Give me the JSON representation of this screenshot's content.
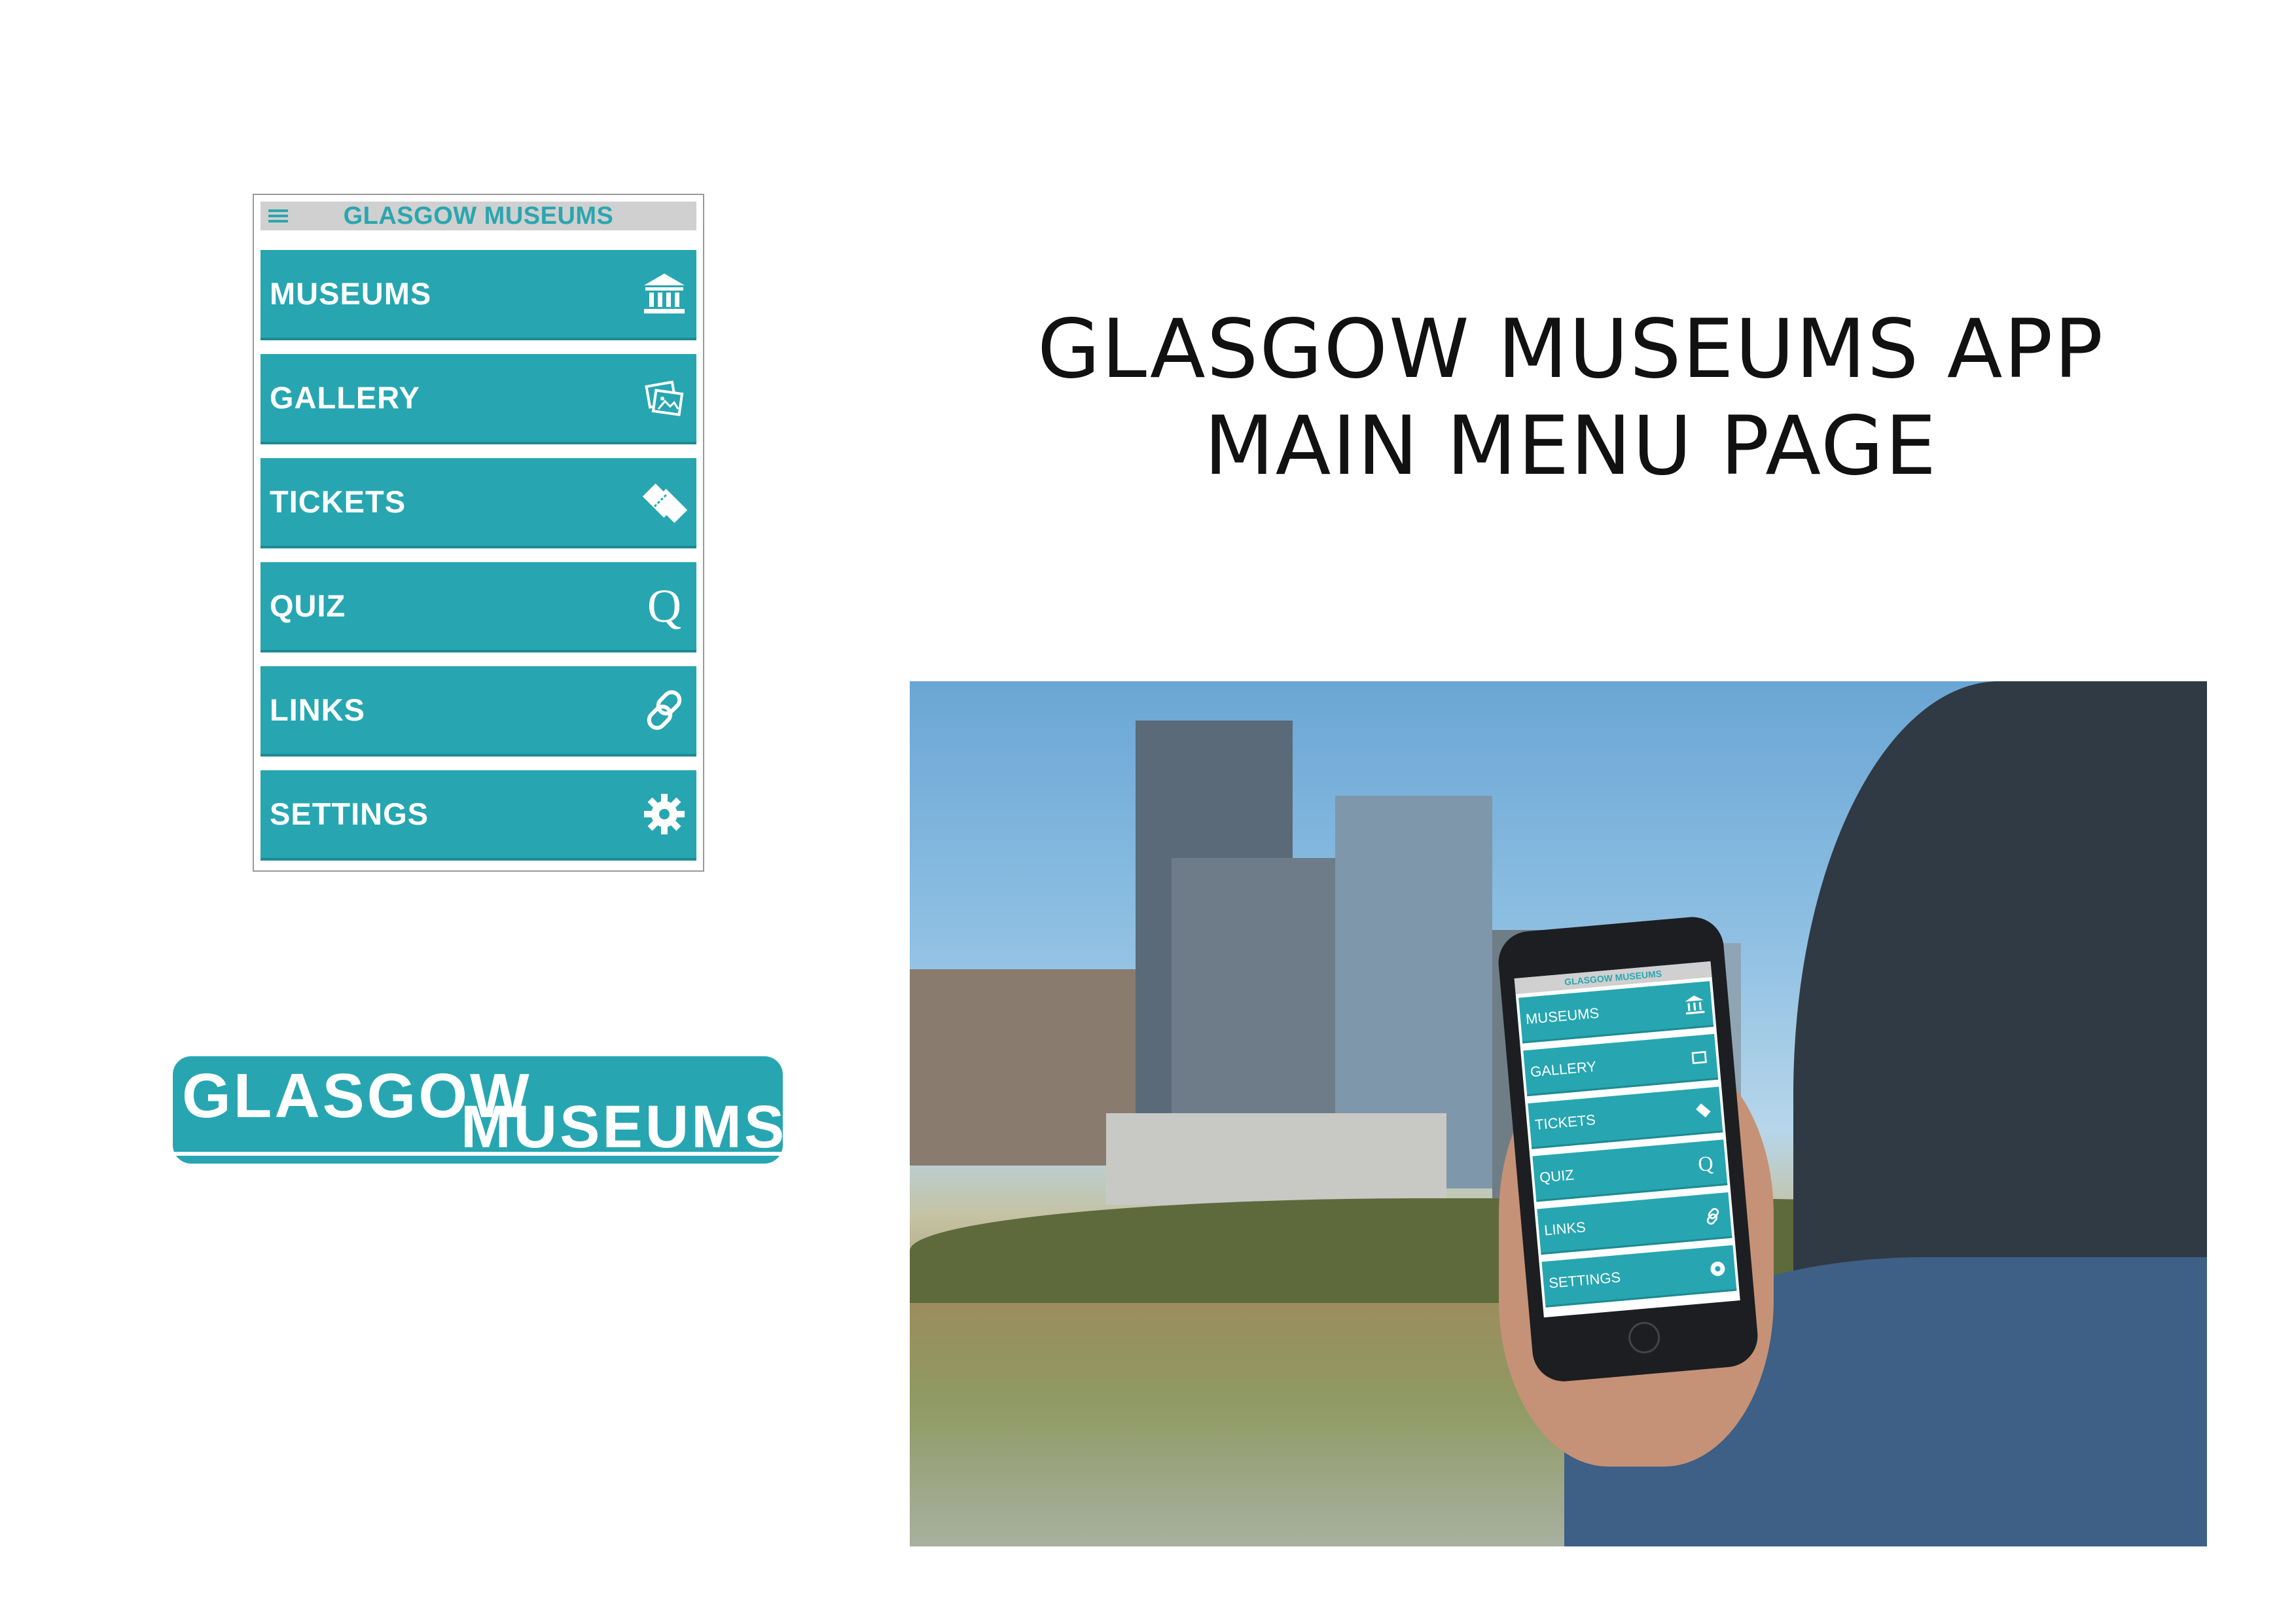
{
  "app": {
    "header_title": "GLASGOW MUSEUMS",
    "menu_icon": "hamburger-icon",
    "accent_color": "#27a6b1",
    "header_bg": "#d0d0d0",
    "items": [
      {
        "label": "MUSEUMS",
        "icon": "museum-icon"
      },
      {
        "label": "GALLERY",
        "icon": "gallery-icon"
      },
      {
        "label": "TICKETS",
        "icon": "tickets-icon"
      },
      {
        "label": "QUIZ",
        "icon": "quiz-icon",
        "glyph": "Q"
      },
      {
        "label": "LINKS",
        "icon": "link-icon"
      },
      {
        "label": "SETTINGS",
        "icon": "gear-icon"
      }
    ]
  },
  "heading": {
    "line1": "GLASGOW MUSEUMS APP",
    "line2": "MAIN MENU PAGE"
  },
  "logo": {
    "line1": "GLASGOW",
    "line2": "MUSEUMS"
  },
  "photo_phone": {
    "header_title": "GLASGOW MUSEUMS",
    "items": [
      {
        "label": "MUSEUMS",
        "icon": "museum-icon"
      },
      {
        "label": "GALLERY",
        "icon": "gallery-icon"
      },
      {
        "label": "TICKETS",
        "icon": "tickets-icon"
      },
      {
        "label": "QUIZ",
        "icon": "quiz-icon",
        "glyph": "Q"
      },
      {
        "label": "LINKS",
        "icon": "link-icon"
      },
      {
        "label": "SETTINGS",
        "icon": "gear-icon"
      }
    ]
  }
}
